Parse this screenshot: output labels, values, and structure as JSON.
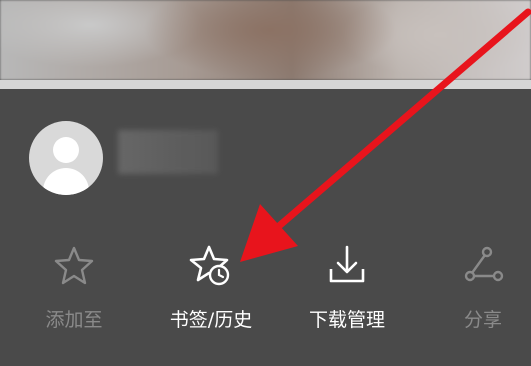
{
  "user": {
    "username_redacted": true
  },
  "actions": [
    {
      "label": "添加至",
      "icon": "star-icon",
      "enabled": false
    },
    {
      "label": "书签/历史",
      "icon": "bookmark-history-icon",
      "enabled": true
    },
    {
      "label": "下载管理",
      "icon": "download-icon",
      "enabled": true
    },
    {
      "label": "分享",
      "icon": "share-icon",
      "enabled": false
    }
  ],
  "annotation": {
    "type": "arrow",
    "color": "#e8141c",
    "points_to": "书签/历史"
  }
}
